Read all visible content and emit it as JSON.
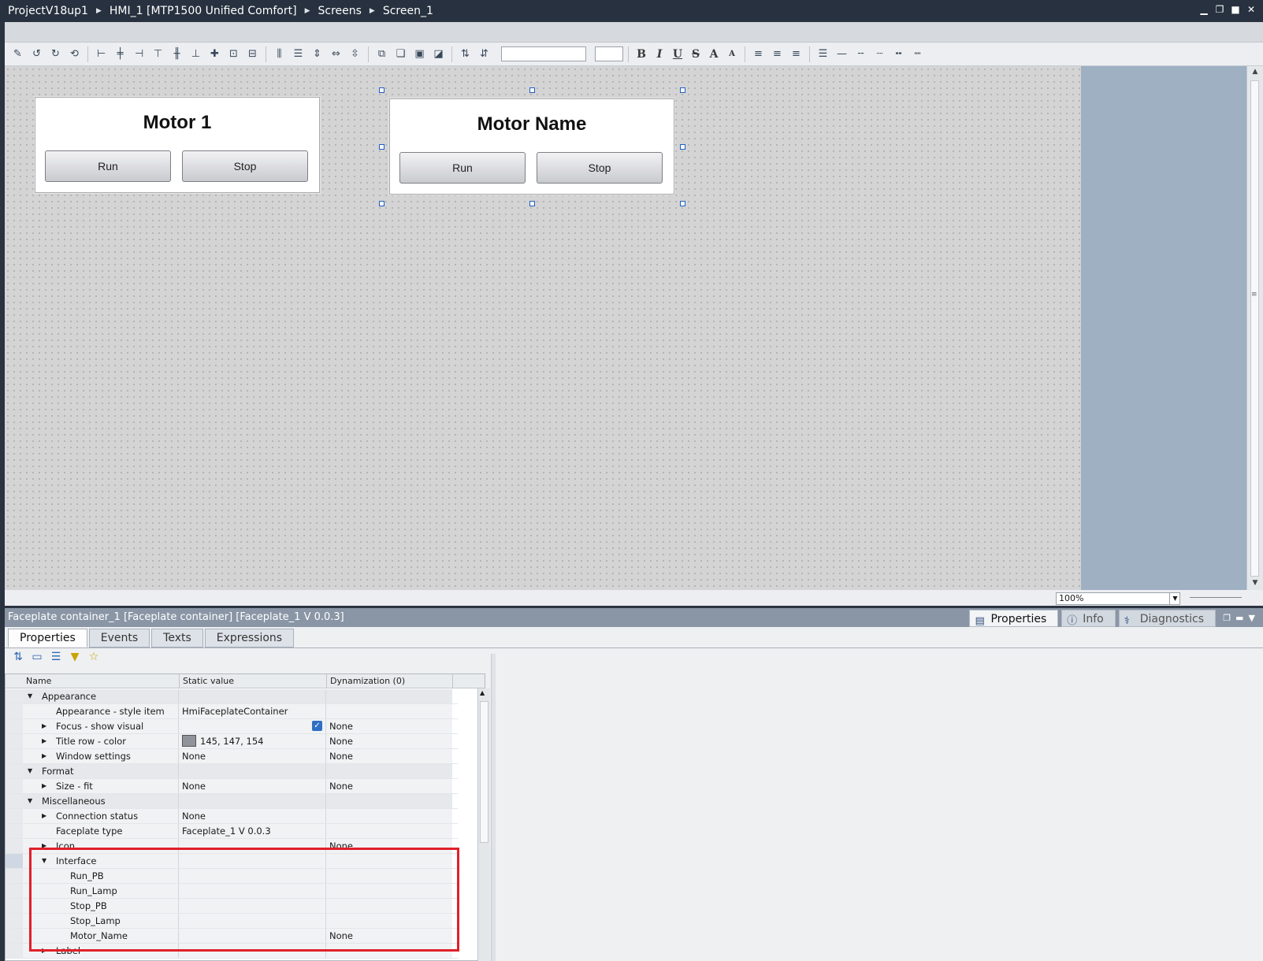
{
  "breadcrumb": [
    "ProjectV18up1",
    "HMI_1 [MTP1500 Unified Comfort]",
    "Screens",
    "Screen_1"
  ],
  "window_controls": [
    "minimize",
    "restore",
    "maximize",
    "close"
  ],
  "toolbar": {
    "bold": "B",
    "italic": "I",
    "underline": "U",
    "strike": "S",
    "grow": "A",
    "shrink": "A"
  },
  "canvas": {
    "faceplates": [
      {
        "title": "Motor 1",
        "run_label": "Run",
        "stop_label": "Stop"
      },
      {
        "title": "Motor Name",
        "run_label": "Run",
        "stop_label": "Stop"
      }
    ]
  },
  "zoom": {
    "value": "100%"
  },
  "inspector": {
    "header": "Faceplate container_1 [Faceplate container] [Faceplate_1 V 0.0.3]",
    "right_tabs": [
      "Properties",
      "Info",
      "Diagnostics"
    ],
    "tabs": [
      "Properties",
      "Events",
      "Texts",
      "Expressions"
    ],
    "columns": [
      "Name",
      "Static value",
      "Dynamization (0)"
    ],
    "rows": [
      {
        "name": "Appearance",
        "static": "",
        "dyn": ""
      },
      {
        "name": "Appearance - style item",
        "static": "HmiFaceplateContainer",
        "dyn": ""
      },
      {
        "name": "Focus - show visual",
        "static": "",
        "dyn": "None"
      },
      {
        "name": "Title row - color",
        "static": "145, 147, 154",
        "dyn": "None"
      },
      {
        "name": "Window settings",
        "static": "None",
        "dyn": "None"
      },
      {
        "name": "Format",
        "static": "",
        "dyn": ""
      },
      {
        "name": "Size - fit",
        "static": "None",
        "dyn": "None"
      },
      {
        "name": "Miscellaneous",
        "static": "",
        "dyn": ""
      },
      {
        "name": "Connection status",
        "static": "None",
        "dyn": ""
      },
      {
        "name": "Faceplate type",
        "static": "Faceplate_1 V 0.0.3",
        "dyn": ""
      },
      {
        "name": "Icon",
        "static": "",
        "dyn": "None"
      },
      {
        "name": "Interface",
        "static": "",
        "dyn": ""
      },
      {
        "name": "Run_PB",
        "static": "",
        "dyn": ""
      },
      {
        "name": "Run_Lamp",
        "static": "",
        "dyn": ""
      },
      {
        "name": "Stop_PB",
        "static": "",
        "dyn": ""
      },
      {
        "name": "Stop_Lamp",
        "static": "",
        "dyn": ""
      },
      {
        "name": "Motor_Name",
        "static": "",
        "dyn": "None"
      },
      {
        "name": "Label",
        "static": "",
        "dyn": ""
      }
    ]
  },
  "colors": {
    "title_row_color": "#91939a",
    "highlight_box": "#e0202a"
  }
}
